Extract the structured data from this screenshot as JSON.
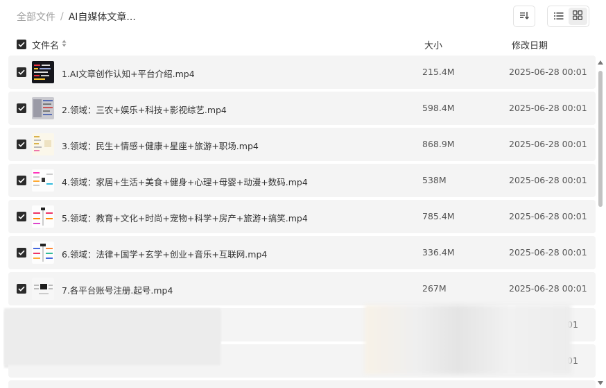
{
  "breadcrumb": {
    "root": "全部文件",
    "separator": "/",
    "current": "AI自媒体文章..."
  },
  "toolbar": {
    "sort_icon": "sort-icon",
    "list_view_icon": "list-view-icon",
    "grid_view_icon": "grid-view-icon",
    "active_view": "list"
  },
  "header": {
    "name": "文件名",
    "size": "大小",
    "modified": "修改日期"
  },
  "files": [
    {
      "name": "1.AI文章创作认知+平台介绍.mp4",
      "size": "215.4M",
      "date": "2025-06-28 00:01",
      "checked": true
    },
    {
      "name": "2.领域：三农+娱乐+科技+影视综艺.mp4",
      "size": "598.4M",
      "date": "2025-06-28 00:01",
      "checked": true
    },
    {
      "name": "3.领域：民生+情感+健康+星座+旅游+职场.mp4",
      "size": "868.9M",
      "date": "2025-06-28 00:01",
      "checked": true
    },
    {
      "name": "4.领域：家居+生活+美食+健身+心理+母婴+动漫+数码.mp4",
      "size": "538M",
      "date": "2025-06-28 00:01",
      "checked": true
    },
    {
      "name": "5.领域：教育+文化+时尚+宠物+科学+房产+旅游+搞笑.mp4",
      "size": "785.4M",
      "date": "2025-06-28 00:01",
      "checked": true
    },
    {
      "name": "6.领域：法律+国学+玄学+创业+音乐+互联网.mp4",
      "size": "336.4M",
      "date": "2025-06-28 00:01",
      "checked": true
    },
    {
      "name": "7.各平台账号注册.起号.mp4",
      "size": "267M",
      "date": "2025-06-28 00:01",
      "checked": true
    }
  ],
  "obscured_rows": [
    {
      "date_tail": "01"
    },
    {
      "date_tail": "01"
    }
  ],
  "colors": {
    "checkbox": "#2b2b2b",
    "row_bg": "#f4f4f4",
    "scrollbar": "#c2c2c2"
  }
}
